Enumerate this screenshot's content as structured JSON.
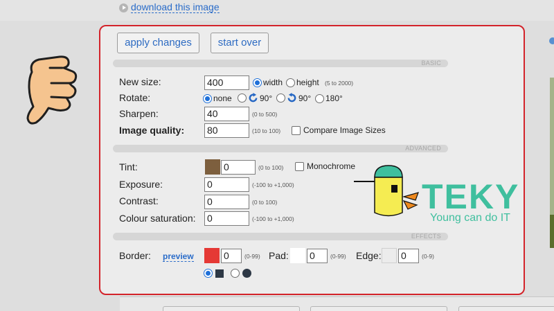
{
  "header": {
    "download_link": "download this image"
  },
  "toolbar": {
    "apply_label": "apply changes",
    "start_over_label": "start over"
  },
  "sections": {
    "basic": "BASIC",
    "advanced": "ADVANCED",
    "effects": "EFFECTS"
  },
  "basic": {
    "new_size_label": "New size:",
    "new_size_value": "400",
    "width_label": "width",
    "height_label": "height",
    "size_hint": "(5 to 2000)",
    "rotate_label": "Rotate:",
    "rotate_none": "none",
    "rotate_cw": "90°",
    "rotate_ccw": "90°",
    "rotate_180": "180°",
    "sharpen_label": "Sharpen:",
    "sharpen_value": "40",
    "sharpen_hint": "(0 to 500)",
    "quality_label": "Image quality:",
    "quality_value": "80",
    "quality_hint": "(10 to 100)",
    "compare_label": "Compare Image Sizes"
  },
  "advanced": {
    "tint_label": "Tint:",
    "tint_value": "0",
    "tint_hint": "(0 to 100)",
    "tint_color": "#7d5f3e",
    "monochrome_label": "Monochrome",
    "exposure_label": "Exposure:",
    "exposure_value": "0",
    "exposure_hint": "(-100 to +1,000)",
    "contrast_label": "Contrast:",
    "contrast_value": "0",
    "contrast_hint": "(0 to 100)",
    "saturation_label": "Colour saturation:",
    "saturation_value": "0",
    "saturation_hint": "(-100 to +1,000)"
  },
  "effects": {
    "border_label": "Border:",
    "preview_link": "preview",
    "border_color": "#e53935",
    "border_value": "0",
    "border_hint": "(0-99)",
    "pad_label": "Pad:",
    "pad_color": "#ffffff",
    "pad_value": "0",
    "pad_hint": "(0-99)",
    "edge_label": "Edge:",
    "edge_color": "#ececec",
    "edge_value": "0",
    "edge_hint": "(0-9)"
  },
  "brand": {
    "logo_text": "TEKY",
    "tagline": "Young can do IT",
    "accent": "#3fbf9e"
  },
  "colors": {
    "panel_border": "#d3232a",
    "link": "#2a6cc9",
    "radio_on": "#1d6fd8"
  }
}
